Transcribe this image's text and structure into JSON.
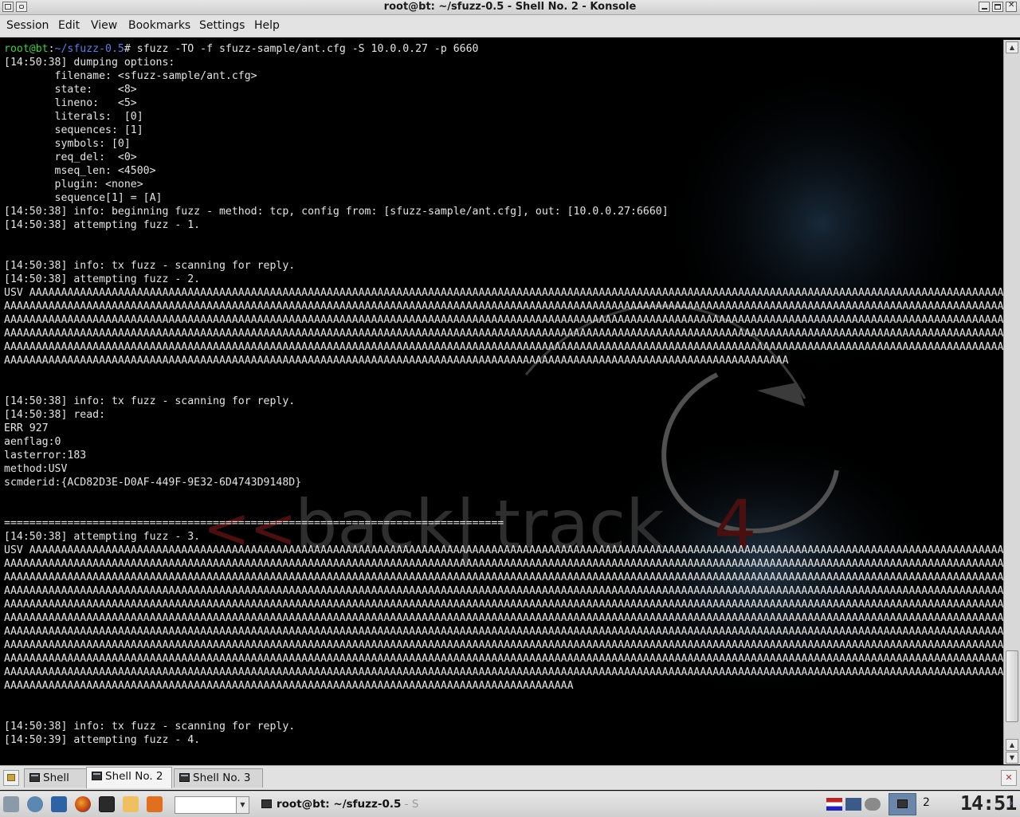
{
  "window": {
    "title": "root@bt: ~/sfuzz-0.5 - Shell No. 2 - Konsole"
  },
  "menubar": {
    "items": [
      "Session",
      "Edit",
      "View",
      "Bookmarks",
      "Settings",
      "Help"
    ]
  },
  "terminal": {
    "prompt_user": "root@bt",
    "prompt_sep": ":",
    "prompt_path": "~/sfuzz-0.5",
    "command": "# sfuzz -TO -f sfuzz-sample/ant.cfg -S 10.0.0.27 -p 6660",
    "lines": [
      "[14:50:38] dumping options:",
      "        filename: <sfuzz-sample/ant.cfg>",
      "        state:    <8>",
      "        lineno:   <5>",
      "        literals:  [0]",
      "        sequences: [1]",
      "        symbols: [0]",
      "        req_del:  <0>",
      "        mseq_len: <4500>",
      "        plugin: <none>",
      "        sequence[1] = [A]",
      "[14:50:38] info: beginning fuzz - method: tcp, config from: [sfuzz-sample/ant.cfg], out: [10.0.0.27:6660]",
      "[14:50:38] attempting fuzz - 1.",
      "",
      "",
      "[14:50:38] info: tx fuzz - scanning for reply.",
      "[14:50:38] attempting fuzz - 2.",
      "USV AAAAAAAAAAAAAAAAAAAAAAAAAAAAAAAAAAAAAAAAAAAAAAAAAAAAAAAAAAAAAAAAAAAAAAAAAAAAAAAAAAAAAAAAAAAAAAAAAAAAAAAAAAAAAAAAAAAAAAAAAAAAAAAAAAAAAAAAAAAAAAAAAAAAAAAAAAA",
      "AAAAAAAAAAAAAAAAAAAAAAAAAAAAAAAAAAAAAAAAAAAAAAAAAAAAAAAAAAAAAAAAAAAAAAAAAAAAAAAAAAAAAAAAAAAAAAAAAAAAAAAAAAAAAAAAAAAAAAAAAAAAAAAAAAAAAAAAAAAAAAAAAAAAAAAAAAAAAAAA",
      "AAAAAAAAAAAAAAAAAAAAAAAAAAAAAAAAAAAAAAAAAAAAAAAAAAAAAAAAAAAAAAAAAAAAAAAAAAAAAAAAAAAAAAAAAAAAAAAAAAAAAAAAAAAAAAAAAAAAAAAAAAAAAAAAAAAAAAAAAAAAAAAAAAAAAAAAAAAAAAAA",
      "AAAAAAAAAAAAAAAAAAAAAAAAAAAAAAAAAAAAAAAAAAAAAAAAAAAAAAAAAAAAAAAAAAAAAAAAAAAAAAAAAAAAAAAAAAAAAAAAAAAAAAAAAAAAAAAAAAAAAAAAAAAAAAAAAAAAAAAAAAAAAAAAAAAAAAAAAAAAAAAA",
      "AAAAAAAAAAAAAAAAAAAAAAAAAAAAAAAAAAAAAAAAAAAAAAAAAAAAAAAAAAAAAAAAAAAAAAAAAAAAAAAAAAAAAAAAAAAAAAAAAAAAAAAAAAAAAAAAAAAAAAAAAAAAAAAAAAAAAAAAAAAAAAAAAAAAAAAAAAAAAAAA",
      "AAAAAAAAAAAAAAAAAAAAAAAAAAAAAAAAAAAAAAAAAAAAAAAAAAAAAAAAAAAAAAAAAAAAAAAAAAAAAAAAAAAAAAAAAAAAAAAAAAAAAAAAAAAAAAAAAAAAAAAAAAAA",
      "",
      "",
      "[14:50:38] info: tx fuzz - scanning for reply.",
      "[14:50:38] read:",
      "ERR 927",
      "aenflag:0",
      "lasterror:183",
      "method:USV",
      "scmderid:{ACD82D3E-D0AF-449F-9E32-6D4743D9148D}",
      "",
      "",
      "===============================================================================",
      "[14:50:38] attempting fuzz - 3.",
      "USV AAAAAAAAAAAAAAAAAAAAAAAAAAAAAAAAAAAAAAAAAAAAAAAAAAAAAAAAAAAAAAAAAAAAAAAAAAAAAAAAAAAAAAAAAAAAAAAAAAAAAAAAAAAAAAAAAAAAAAAAAAAAAAAAAAAAAAAAAAAAAAAAAAAAAAAAAAA",
      "AAAAAAAAAAAAAAAAAAAAAAAAAAAAAAAAAAAAAAAAAAAAAAAAAAAAAAAAAAAAAAAAAAAAAAAAAAAAAAAAAAAAAAAAAAAAAAAAAAAAAAAAAAAAAAAAAAAAAAAAAAAAAAAAAAAAAAAAAAAAAAAAAAAAAAAAAAAAAAAA",
      "AAAAAAAAAAAAAAAAAAAAAAAAAAAAAAAAAAAAAAAAAAAAAAAAAAAAAAAAAAAAAAAAAAAAAAAAAAAAAAAAAAAAAAAAAAAAAAAAAAAAAAAAAAAAAAAAAAAAAAAAAAAAAAAAAAAAAAAAAAAAAAAAAAAAAAAAAAAAAAAA",
      "AAAAAAAAAAAAAAAAAAAAAAAAAAAAAAAAAAAAAAAAAAAAAAAAAAAAAAAAAAAAAAAAAAAAAAAAAAAAAAAAAAAAAAAAAAAAAAAAAAAAAAAAAAAAAAAAAAAAAAAAAAAAAAAAAAAAAAAAAAAAAAAAAAAAAAAAAAAAAAAA",
      "AAAAAAAAAAAAAAAAAAAAAAAAAAAAAAAAAAAAAAAAAAAAAAAAAAAAAAAAAAAAAAAAAAAAAAAAAAAAAAAAAAAAAAAAAAAAAAAAAAAAAAAAAAAAAAAAAAAAAAAAAAAAAAAAAAAAAAAAAAAAAAAAAAAAAAAAAAAAAAAA",
      "AAAAAAAAAAAAAAAAAAAAAAAAAAAAAAAAAAAAAAAAAAAAAAAAAAAAAAAAAAAAAAAAAAAAAAAAAAAAAAAAAAAAAAAAAAAAAAAAAAAAAAAAAAAAAAAAAAAAAAAAAAAAAAAAAAAAAAAAAAAAAAAAAAAAAAAAAAAAAAAA",
      "AAAAAAAAAAAAAAAAAAAAAAAAAAAAAAAAAAAAAAAAAAAAAAAAAAAAAAAAAAAAAAAAAAAAAAAAAAAAAAAAAAAAAAAAAAAAAAAAAAAAAAAAAAAAAAAAAAAAAAAAAAAAAAAAAAAAAAAAAAAAAAAAAAAAAAAAAAAAAAAA",
      "AAAAAAAAAAAAAAAAAAAAAAAAAAAAAAAAAAAAAAAAAAAAAAAAAAAAAAAAAAAAAAAAAAAAAAAAAAAAAAAAAAAAAAAAAAAAAAAAAAAAAAAAAAAAAAAAAAAAAAAAAAAAAAAAAAAAAAAAAAAAAAAAAAAAAAAAAAAAAAAA",
      "AAAAAAAAAAAAAAAAAAAAAAAAAAAAAAAAAAAAAAAAAAAAAAAAAAAAAAAAAAAAAAAAAAAAAAAAAAAAAAAAAAAAAAAAAAAAAAAAAAAAAAAAAAAAAAAAAAAAAAAAAAAAAAAAAAAAAAAAAAAAAAAAAAAAAAAAAAAAAAAA",
      "AAAAAAAAAAAAAAAAAAAAAAAAAAAAAAAAAAAAAAAAAAAAAAAAAAAAAAAAAAAAAAAAAAAAAAAAAAAAAAAAAAAAAAAAAAAAAAAAAAAAAAAAAAAAAAAAAAAAAAAAAAAAAAAAAAAAAAAAAAAAAAAAAAAAAAAAAAAAAAAA",
      "AAAAAAAAAAAAAAAAAAAAAAAAAAAAAAAAAAAAAAAAAAAAAAAAAAAAAAAAAAAAAAAAAAAAAAAAAAAAAAAAAAAAAAAAAA",
      "",
      "",
      "[14:50:38] info: tx fuzz - scanning for reply.",
      "[14:50:39] attempting fuzz - 4."
    ]
  },
  "wallpaper": {
    "logo_word1": "back",
    "logo_sep": "|",
    "logo_word2": "track",
    "logo_num": "4",
    "logo_arrows": "<<"
  },
  "tabs": [
    {
      "label": "Shell",
      "active": false
    },
    {
      "label": "Shell No. 2",
      "active": true
    },
    {
      "label": "Shell No. 3",
      "active": false
    }
  ],
  "taskbar": {
    "task_label": "root@bt: ~/sfuzz-0.5",
    "task_label_fade": " - S",
    "desktop_number": "2",
    "clock": "14:51",
    "launchers": [
      "kmenu-icon",
      "system-settings-icon",
      "desktop-icon",
      "firefox-icon",
      "terminal-icon",
      "notes-icon",
      "tools-icon"
    ]
  },
  "colors": {
    "prompt_user": "#3fcf3f",
    "prompt_path": "#5a7fe6",
    "terminal_bg": "#000000",
    "terminal_fg": "#e4e4e4",
    "logo_red": "#7a1212"
  }
}
